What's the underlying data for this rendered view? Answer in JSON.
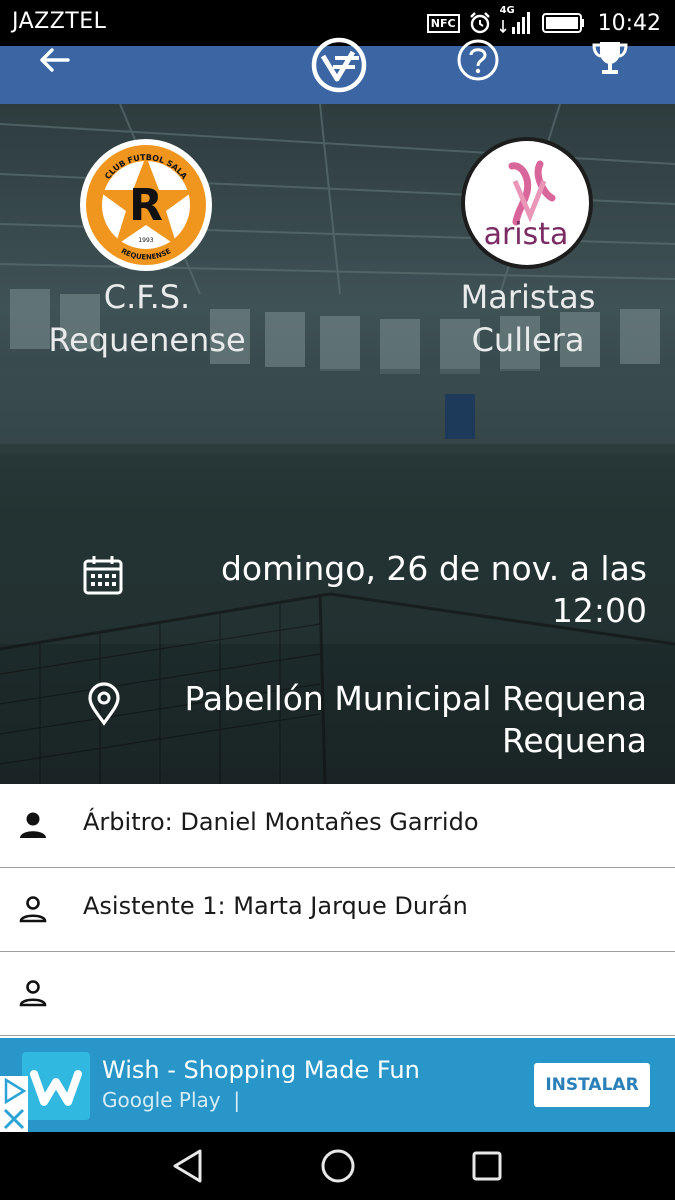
{
  "status_bar": {
    "carrier": "JAZZTEL",
    "nfc": "NFC",
    "network": "4G",
    "time": "10:42"
  },
  "top_bar": {
    "icons": [
      "back-arrow-icon",
      "federation-logo-icon",
      "help-icon",
      "trophy-icon"
    ],
    "color": "#3b66a3"
  },
  "match": {
    "home_team": {
      "name_line1": "C.F.S.",
      "name_line2": "Requenense"
    },
    "away_team": {
      "name_line1": "Maristas",
      "name_line2": "Cullera"
    },
    "home_crest": {
      "top_text": "CLUB FUTBOL SALA",
      "letter": "R",
      "year": "1993",
      "bottom_text": "REQUENENSE"
    },
    "away_crest": {
      "text": "arista"
    },
    "date_line1": "domingo, 26 de nov. a las",
    "date_line2": "12:00",
    "venue_line1": "Pabellón Municipal Requena",
    "venue_line2": "Requena"
  },
  "officials": [
    {
      "text": "Árbitro: Daniel Montañes Garrido",
      "icon": "person-filled-icon"
    },
    {
      "text": "Asistente 1: Marta Jarque Durán",
      "icon": "person-outline-icon"
    },
    {
      "text": "",
      "icon": "person-outline-icon"
    }
  ],
  "ad": {
    "title": "Wish - Shopping Made Fun",
    "store": "Google Play",
    "separator": "|",
    "install_label": "INSTALAR",
    "color": "#2896c8"
  },
  "nav_bar": {
    "icons": [
      "back-triangle-icon",
      "home-circle-icon",
      "recents-square-icon"
    ]
  }
}
